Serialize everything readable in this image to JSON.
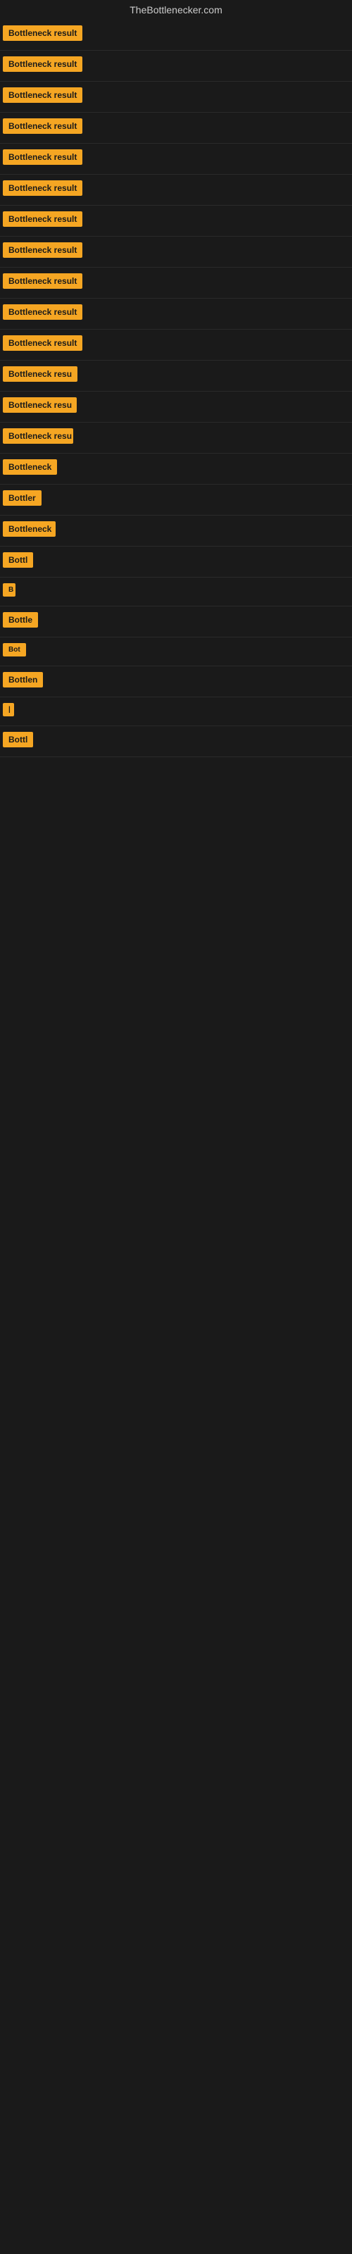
{
  "header": {
    "title": "TheBottlenecker.com"
  },
  "results": [
    {
      "label": "Bottleneck result",
      "width": 130
    },
    {
      "label": "Bottleneck result",
      "width": 130
    },
    {
      "label": "Bottleneck result",
      "width": 130
    },
    {
      "label": "Bottleneck result",
      "width": 130
    },
    {
      "label": "Bottleneck result",
      "width": 130
    },
    {
      "label": "Bottleneck result",
      "width": 130
    },
    {
      "label": "Bottleneck result",
      "width": 130
    },
    {
      "label": "Bottleneck result",
      "width": 130
    },
    {
      "label": "Bottleneck result",
      "width": 130
    },
    {
      "label": "Bottleneck result",
      "width": 130
    },
    {
      "label": "Bottleneck result",
      "width": 118
    },
    {
      "label": "Bottleneck resu",
      "width": 110
    },
    {
      "label": "Bottleneck resu",
      "width": 105
    },
    {
      "label": "Bottleneck resu",
      "width": 100
    },
    {
      "label": "Bottleneck",
      "width": 80
    },
    {
      "label": "Bottler",
      "width": 60
    },
    {
      "label": "Bottleneck",
      "width": 75
    },
    {
      "label": "Bottl",
      "width": 48
    },
    {
      "label": "B",
      "width": 18
    },
    {
      "label": "Bottle",
      "width": 52
    },
    {
      "label": "Bot",
      "width": 36
    },
    {
      "label": "Bottlen",
      "width": 62
    },
    {
      "label": "|",
      "width": 10
    },
    {
      "label": "Bottl",
      "width": 48
    }
  ]
}
